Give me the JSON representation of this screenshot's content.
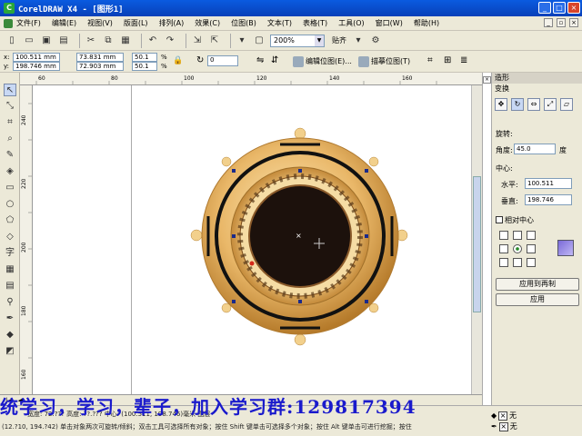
{
  "window": {
    "title": "CorelDRAW X4 - [图形1]",
    "app_icon": "coreldraw-icon"
  },
  "menu": {
    "items": [
      "文件(F)",
      "编辑(E)",
      "视图(V)",
      "版面(L)",
      "排列(A)",
      "效果(C)",
      "位图(B)",
      "文本(T)",
      "表格(T)",
      "工具(O)",
      "窗口(W)",
      "帮助(H)"
    ]
  },
  "toolbar": {
    "zoom": "200%",
    "snap": "贴齐"
  },
  "propbar": {
    "x": "100.511 mm",
    "y": "198.746 mm",
    "w": "73.831 mm",
    "h": "72.903 mm",
    "sx": "50.1",
    "sy": "50.1",
    "pct": "%",
    "rotate": "0",
    "edit_position": "编辑位图(E)...",
    "trace_bitmap": "描摹位图(T)"
  },
  "docker": {
    "tab": "造形",
    "title": "变换",
    "rotation_label": "旋转:",
    "angle_label": "角度:",
    "angle_value": "45.0",
    "angle_unit": "度",
    "center_label": "中心:",
    "h_label": "水平:",
    "h_value": "100.511",
    "v_label": "垂直:",
    "v_value": "198.746",
    "relative_center": "相对中心",
    "apply_copy": "应用到再制",
    "apply": "应用"
  },
  "status": {
    "line1": "宽度: 72.??? 高度: ??.??? 中心: (100.511, 198.746)毫米         图层",
    "line2": "(12.?10, 194.?42)   单击对象两次可旋转/倾斜；双击工具可选择所有对象；按住 Shift 键单击可选择多个对象；按住 Alt 键单击可进行挖掘；按住",
    "fill1": "无",
    "fill2": "无"
  },
  "overlay_text": "统学习，学习，辈子，加入学习群:129817394",
  "rulers": {
    "h": [
      "60",
      "80",
      "100",
      "120",
      "140",
      "160"
    ],
    "v": [
      "240",
      "220",
      "200",
      "180",
      "160"
    ]
  }
}
